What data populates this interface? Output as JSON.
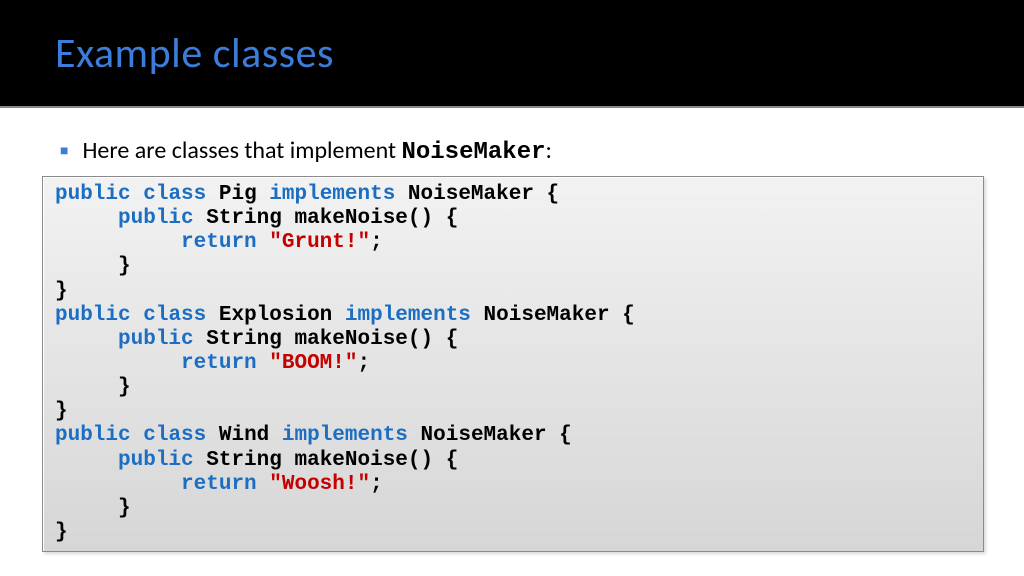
{
  "title": "Example classes",
  "bullet": {
    "prefix": "Here are classes that implement ",
    "interface": "NoiseMaker",
    "suffix": ":"
  },
  "code": {
    "kw_public": "public",
    "kw_class": "class",
    "kw_implements": "implements",
    "kw_return": "return",
    "type_string": "String",
    "iface": "NoiseMaker",
    "method": "makeNoise()",
    "classes": [
      {
        "name": "Pig",
        "ret": "\"Grunt!\""
      },
      {
        "name": "Explosion",
        "ret": "\"BOOM!\""
      },
      {
        "name": "Wind",
        "ret": "\"Woosh!\""
      }
    ]
  }
}
